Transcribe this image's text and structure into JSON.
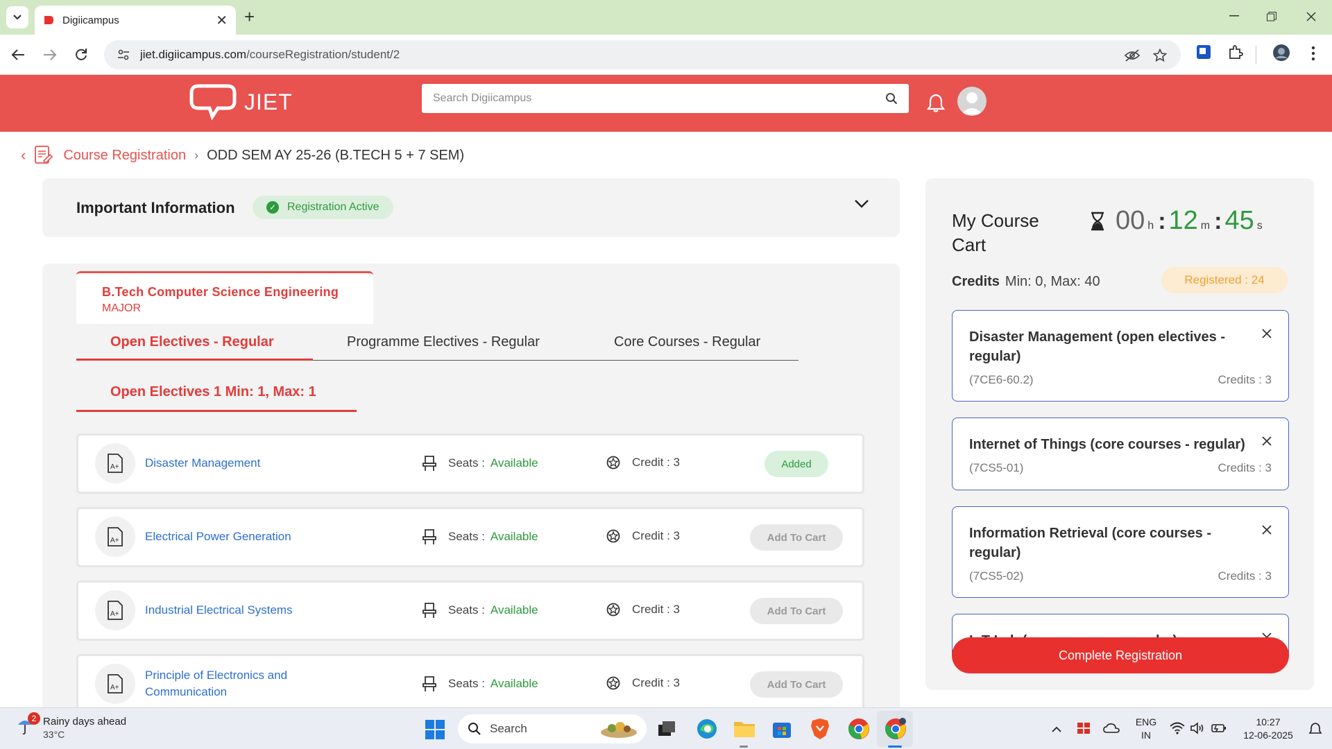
{
  "browser": {
    "tab_title": "Digiicampus",
    "url_domain": "jiet.digiicampus.com",
    "url_path": "/courseRegistration/student/2"
  },
  "header": {
    "logo_text": "JIET",
    "search_placeholder": "Search Digiicampus",
    "brand_color": "#e8524f"
  },
  "breadcrumb": {
    "parent": "Course Registration",
    "current": "ODD SEM AY 25-26 (B.TECH 5 + 7 SEM)"
  },
  "info": {
    "title": "Important Information",
    "status": "Registration Active"
  },
  "program": {
    "name": "B.Tech Computer Science Engineering",
    "type": "MAJOR"
  },
  "tabs": [
    {
      "label": "Open Electives - Regular",
      "active": true
    },
    {
      "label": "Programme Electives - Regular",
      "active": false
    },
    {
      "label": "Core Courses - Regular",
      "active": false
    }
  ],
  "group_tab": "Open Electives 1 Min: 1, Max: 1",
  "courses": [
    {
      "name": "Disaster Management",
      "seats_label": "Seats :",
      "seats_value": "Available",
      "credit": "Credit : 3",
      "action": "Added"
    },
    {
      "name": "Electrical Power Generation",
      "seats_label": "Seats :",
      "seats_value": "Available",
      "credit": "Credit : 3",
      "action": "Add To Cart"
    },
    {
      "name": "Industrial Electrical Systems",
      "seats_label": "Seats :",
      "seats_value": "Available",
      "credit": "Credit : 3",
      "action": "Add To Cart"
    },
    {
      "name": "Principle of Electronics and Communication",
      "seats_label": "Seats :",
      "seats_value": "Available",
      "credit": "Credit : 3",
      "action": "Add To Cart"
    }
  ],
  "cart": {
    "title": "My Course Cart",
    "timer": {
      "h": "00",
      "h_unit": "h",
      "m": "12",
      "m_unit": "m",
      "s": "45",
      "s_unit": "s"
    },
    "credits_label": "Credits",
    "credits_range": "Min: 0, Max: 40",
    "registered": "Registered : 24",
    "items": [
      {
        "title": "Disaster Management (open electives - regular)",
        "code": "(7CE6-60.2)",
        "credits": "Credits : 3"
      },
      {
        "title": "Internet of Things (core courses - regular)",
        "code": "(7CS5-01)",
        "credits": "Credits : 3"
      },
      {
        "title": "Information Retrieval (core courses - regular)",
        "code": "(7CS5-02)",
        "credits": "Credits : 3"
      },
      {
        "title": "IoT Lab (core courses - regular)",
        "code": "",
        "credits": ""
      }
    ],
    "complete_button": "Complete Registration"
  },
  "taskbar": {
    "weather_title": "Rainy days ahead",
    "weather_temp": "33°C",
    "weather_badge": "2",
    "search_label": "Search",
    "lang_1": "ENG",
    "lang_2": "IN",
    "time": "10:27",
    "date": "12-06-2025"
  }
}
